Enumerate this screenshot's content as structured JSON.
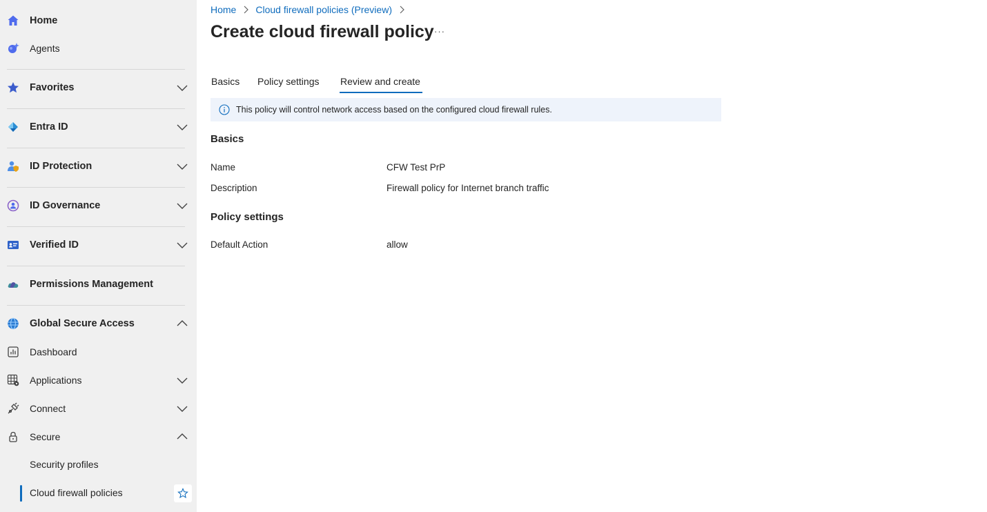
{
  "sidebar": {
    "items": [
      {
        "label": "Home",
        "icon": "home-icon"
      },
      {
        "label": "Agents",
        "icon": "agents-icon"
      },
      {
        "label": "Favorites",
        "icon": "star-icon"
      },
      {
        "label": "Entra ID",
        "icon": "entra-id-icon"
      },
      {
        "label": "ID Protection",
        "icon": "id-protection-icon"
      },
      {
        "label": "ID Governance",
        "icon": "id-governance-icon"
      },
      {
        "label": "Verified ID",
        "icon": "verified-id-icon"
      },
      {
        "label": "Permissions Management",
        "icon": "permissions-cloud-icon"
      },
      {
        "label": "Global Secure Access",
        "icon": "globe-icon"
      },
      {
        "label": "Dashboard",
        "icon": "dashboard-icon"
      },
      {
        "label": "Applications",
        "icon": "applications-icon"
      },
      {
        "label": "Connect",
        "icon": "connect-plug-icon"
      },
      {
        "label": "Secure",
        "icon": "lock-icon"
      },
      {
        "label": "Security profiles"
      },
      {
        "label": "Cloud firewall policies",
        "selected": true
      }
    ]
  },
  "breadcrumb": {
    "home": "Home",
    "parent": "Cloud firewall policies (Preview)"
  },
  "page": {
    "title": "Create cloud firewall policy",
    "more": "···"
  },
  "tabs": [
    {
      "label": "Basics"
    },
    {
      "label": "Policy settings"
    },
    {
      "label": "Review and create",
      "active": true
    }
  ],
  "info": {
    "text": "This policy will control network access based on the configured cloud firewall rules."
  },
  "review": {
    "basics_heading": "Basics",
    "name_label": "Name",
    "name_value": "CFW Test PrP",
    "description_label": "Description",
    "description_value": "Firewall policy for Internet branch traffic",
    "policy_heading": "Policy settings",
    "default_action_label": "Default Action",
    "default_action_value": "allow"
  },
  "colors": {
    "accent": "#0f6cbd",
    "sidebar_bg": "#f0f0f0",
    "info_bg": "#eef3fb"
  }
}
